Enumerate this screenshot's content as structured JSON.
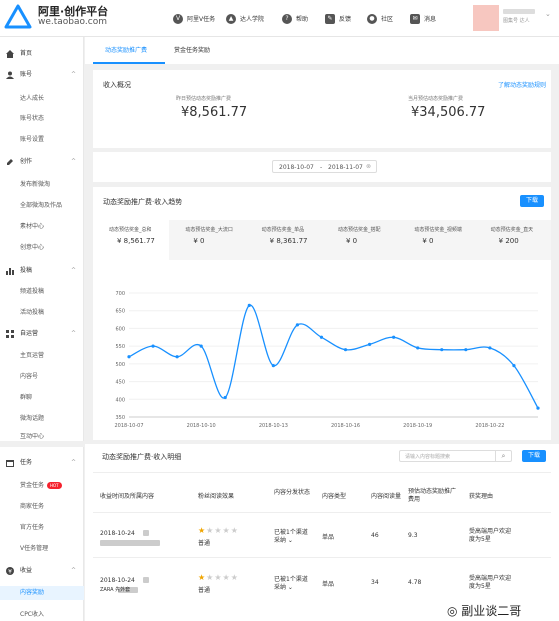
{
  "header": {
    "logo_title": "阿里·创作平台",
    "logo_sub": "we.taobao.com",
    "nav": [
      {
        "label": "阿里V任务",
        "icon": "v-task-icon"
      },
      {
        "label": "达人学院",
        "icon": "graduation-cap-icon"
      },
      {
        "label": "帮助",
        "icon": "help-icon"
      },
      {
        "label": "反馈",
        "icon": "feedback-icon"
      },
      {
        "label": "社区",
        "icon": "community-icon"
      },
      {
        "label": "消息",
        "icon": "message-icon"
      }
    ],
    "user_sub": "图集号 达人"
  },
  "sidebar": {
    "home": "首页",
    "account": "账号",
    "account_items": [
      "达人成长",
      "账号状态",
      "账号设置"
    ],
    "create": "创作",
    "create_items": [
      "发布新微淘",
      "全部微淘及作品",
      "素材中心",
      "创意中心"
    ],
    "delivery": "投稿",
    "delivery_items": [
      "频道投稿",
      "活动投稿"
    ],
    "operation": "自运营",
    "operation_items": [
      "主页运营",
      "内容号",
      "群聊",
      "微淘话题",
      "互动中心"
    ],
    "task": "任务",
    "task_items": [
      "赏金任务",
      "商家任务",
      "官方任务",
      "V任务管理"
    ],
    "hot_badge": "HOT",
    "income": "收益",
    "income_items": [
      "内容奖励",
      "CPC收入"
    ]
  },
  "tabs": [
    "动态奖励推广费",
    "赏金任务奖励"
  ],
  "overview": {
    "title": "收入概况",
    "link": "了解动态奖励规则",
    "left_label": "昨日预估动态奖励推广费",
    "left_value": "¥8,561.77",
    "right_label": "当月预估动态奖励推广费",
    "right_value": "¥34,506.77"
  },
  "date_range": {
    "start": "2018-10-07",
    "sep": "-",
    "end": "2018-11-07"
  },
  "trend": {
    "title": "动态奖励推广费·收入趋势",
    "download": "下载",
    "metrics": [
      {
        "label": "动态预估奖金_总和",
        "value": "¥ 8,561.77"
      },
      {
        "label": "动态预估奖金_大流口",
        "value": "¥ 0"
      },
      {
        "label": "动态预估奖金_单品",
        "value": "¥ 8,361.77"
      },
      {
        "label": "动态预估奖金_搭配",
        "value": "¥ 0"
      },
      {
        "label": "动态预估奖金_视频端",
        "value": "¥ 0"
      },
      {
        "label": "动态预估奖金_直天",
        "value": "¥ 200"
      }
    ]
  },
  "chart_data": {
    "type": "line",
    "ylim": [
      350,
      700
    ],
    "yticks": [
      700,
      650,
      600,
      550,
      500,
      450,
      400,
      350
    ],
    "xticks": [
      "2018-10-07",
      "2018-10-10",
      "2018-10-13",
      "2018-10-16",
      "2018-10-19",
      "2018-10-22"
    ],
    "x": [
      "2018-10-07",
      "2018-10-08",
      "2018-10-09",
      "2018-10-10",
      "2018-10-11",
      "2018-10-12",
      "2018-10-13",
      "2018-10-14",
      "2018-10-15",
      "2018-10-16",
      "2018-10-17",
      "2018-10-18",
      "2018-10-19",
      "2018-10-20",
      "2018-10-21",
      "2018-10-22",
      "2018-10-23",
      "2018-10-24"
    ],
    "values": [
      520,
      550,
      520,
      550,
      405,
      665,
      495,
      610,
      575,
      540,
      555,
      575,
      545,
      540,
      540,
      545,
      495,
      375
    ],
    "color": "#1890ff"
  },
  "details": {
    "title": "动态奖励推广费·收入明细",
    "search_placeholder": "请输入内容标题搜索",
    "download": "下载",
    "columns": [
      "收益时间及所属内容",
      "粉丝阅读效果",
      "内容分发状态",
      "内容类型",
      "内容阅读量",
      "预估动态奖励推广费用",
      "获奖理由"
    ],
    "rows": [
      {
        "date": "2018-10-24",
        "title_suffix": "",
        "rating": "普通",
        "status": "已被1个渠道采纳",
        "type": "单品",
        "reads": "46",
        "fee": "9.3",
        "reason": "受高端用户欢迎度为5星"
      },
      {
        "date": "2018-10-24",
        "title_suffix": "ZARA 先外套",
        "rating": "普通",
        "status": "已被1个渠道采纳",
        "type": "单品",
        "reads": "34",
        "fee": "4.78",
        "reason": "受高端用户欢迎度为5星"
      }
    ]
  },
  "watermark": "副业谈二哥"
}
